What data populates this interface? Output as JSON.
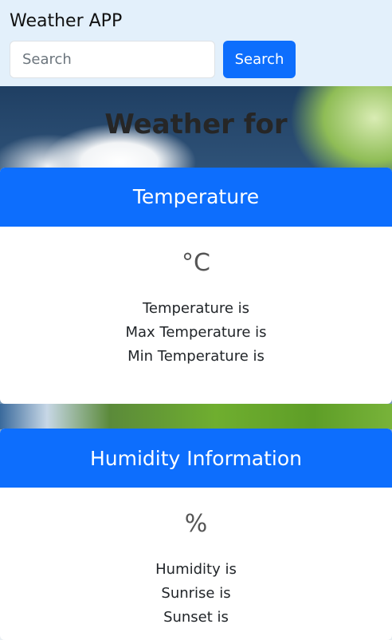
{
  "navbar": {
    "brand": "Weather APP",
    "search_placeholder": "Search",
    "search_button": "Search"
  },
  "main": {
    "title": "Weather for"
  },
  "temperature_card": {
    "header": "Temperature",
    "unit": "°C",
    "lines": [
      "Temperature is",
      "Max Temperature is",
      "Min Temperature is"
    ]
  },
  "humidity_card": {
    "header": "Humidity Information",
    "unit": "%",
    "lines": [
      "Humidity is",
      "Sunrise is",
      "Sunset is"
    ]
  },
  "colors": {
    "navbar_bg": "#e3f0fb",
    "primary": "#0d6efd"
  }
}
